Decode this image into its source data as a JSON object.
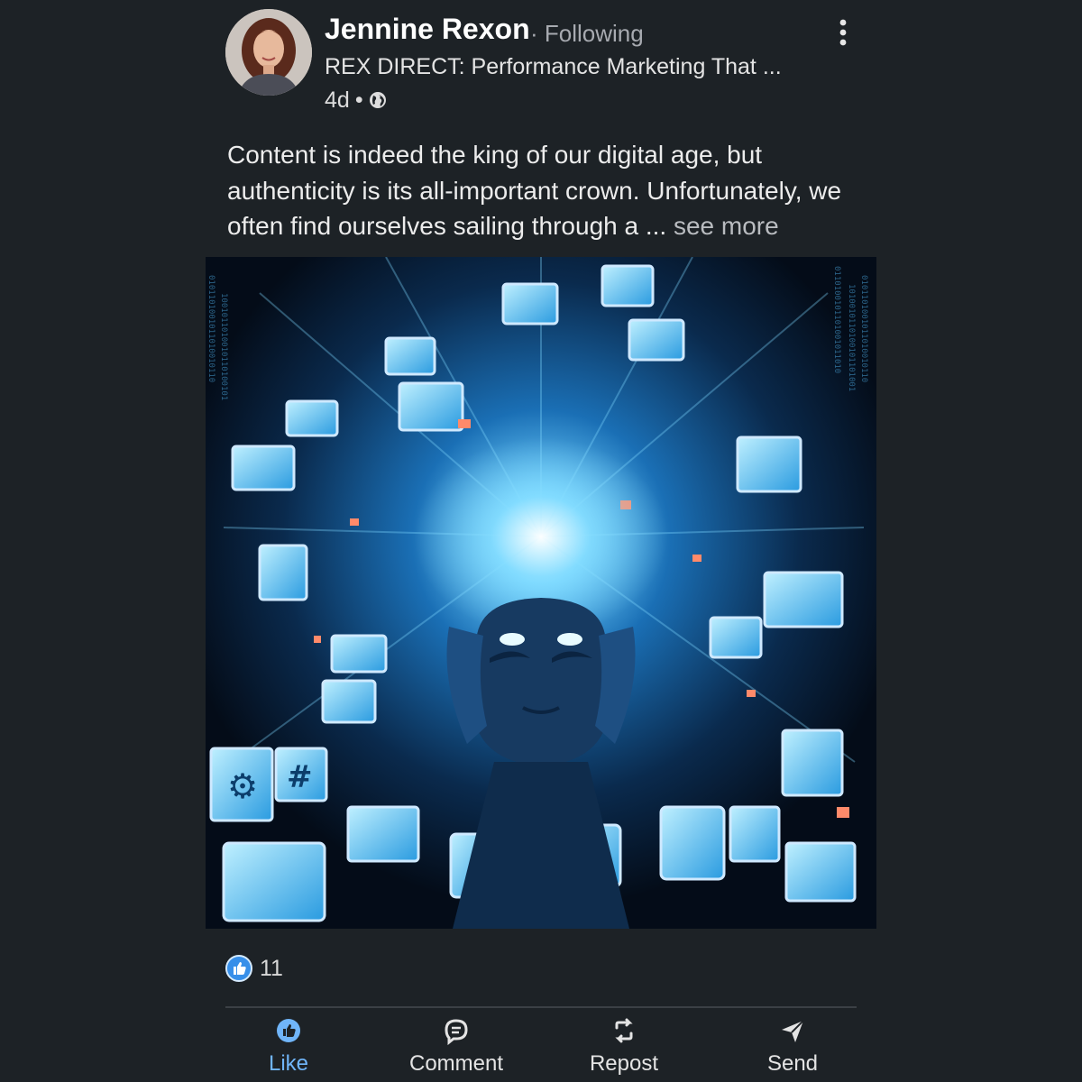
{
  "post": {
    "author": {
      "name": "Jennine Rexon",
      "follow_state": "· Following",
      "headline": "REX DIRECT: Performance Marketing That ...",
      "age": "4d",
      "visibility_icon": "globe-icon"
    },
    "text": "Content is indeed the king of our digital age, but authenticity is its all-important crown. Unfortunately, we often find ourselves sailing through a ...",
    "see_more_label": "see more",
    "image": {
      "description_icon": "ai-art-overloaded-head"
    },
    "reactions": {
      "icon": "like-reaction-icon",
      "count": "11"
    },
    "actions": [
      {
        "label": "Like",
        "icon": "thumbs-up-icon"
      },
      {
        "label": "Comment",
        "icon": "comment-icon"
      },
      {
        "label": "Repost",
        "icon": "repost-icon"
      },
      {
        "label": "Send",
        "icon": "send-icon"
      }
    ]
  },
  "colors": {
    "background": "#1d2226",
    "accent": "#70b5f9",
    "text": "#e9e9e9",
    "secondary_text": "#a7aab0"
  }
}
